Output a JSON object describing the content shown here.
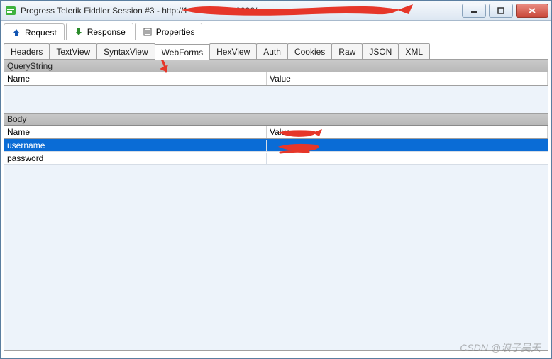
{
  "window": {
    "title_prefix": "Progress Telerik Fiddler Session #3 - http://",
    "title_visible_ip_fragment": "1",
    "title_port_fragment": ".8096/"
  },
  "main_tabs": {
    "request": "Request",
    "response": "Response",
    "properties": "Properties"
  },
  "sub_tabs": {
    "headers": "Headers",
    "textview": "TextView",
    "syntaxview": "SyntaxView",
    "webforms": "WebForms",
    "hexview": "HexView",
    "auth": "Auth",
    "cookies": "Cookies",
    "raw": "Raw",
    "json": "JSON",
    "xml": "XML"
  },
  "sections": {
    "querystring": {
      "label": "QueryString",
      "columns": {
        "name": "Name",
        "value": "Value"
      },
      "rows": []
    },
    "body": {
      "label": "Body",
      "columns": {
        "name": "Name",
        "value": "Value"
      },
      "rows": [
        {
          "name": "username",
          "value": ""
        },
        {
          "name": "password",
          "value": ""
        }
      ]
    }
  },
  "watermark": "CSDN @浪子吴天"
}
